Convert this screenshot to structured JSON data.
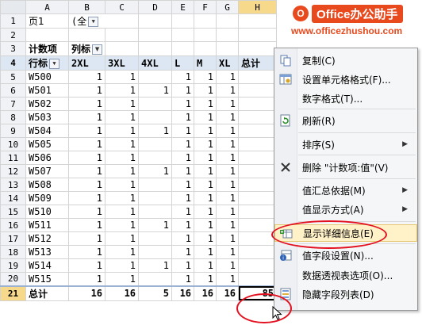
{
  "logo": {
    "badge": "O",
    "brand": "Office办公助手",
    "url": "www.officezhushou.com"
  },
  "sheet": {
    "columns": [
      "A",
      "B",
      "C",
      "D",
      "E",
      "F",
      "G",
      "H"
    ],
    "row_numbers": [
      "1",
      "2",
      "3",
      "4",
      "5",
      "6",
      "7",
      "8",
      "9",
      "10",
      "11",
      "12",
      "13",
      "14",
      "15",
      "16",
      "17",
      "18",
      "19",
      "20",
      "21"
    ],
    "filter": {
      "label": "页1",
      "value": "(全"
    },
    "value_label": "计数项",
    "col_label": "列标",
    "row_label": "行标",
    "headers": [
      "2XL",
      "3XL",
      "4XL",
      "L",
      "M",
      "XL",
      "总计"
    ],
    "rows": [
      {
        "name": "W500",
        "v": [
          "1",
          "1",
          "",
          "1",
          "1",
          "1"
        ]
      },
      {
        "name": "W501",
        "v": [
          "1",
          "1",
          "1",
          "1",
          "1",
          "1"
        ]
      },
      {
        "name": "W502",
        "v": [
          "1",
          "1",
          "",
          "1",
          "1",
          "1"
        ]
      },
      {
        "name": "W503",
        "v": [
          "1",
          "1",
          "",
          "1",
          "1",
          "1"
        ]
      },
      {
        "name": "W504",
        "v": [
          "1",
          "1",
          "1",
          "1",
          "1",
          "1"
        ]
      },
      {
        "name": "W505",
        "v": [
          "1",
          "1",
          "",
          "1",
          "1",
          "1"
        ]
      },
      {
        "name": "W506",
        "v": [
          "1",
          "1",
          "",
          "1",
          "1",
          "1"
        ]
      },
      {
        "name": "W507",
        "v": [
          "1",
          "1",
          "1",
          "1",
          "1",
          "1"
        ]
      },
      {
        "name": "W508",
        "v": [
          "1",
          "1",
          "",
          "1",
          "1",
          "1"
        ]
      },
      {
        "name": "W509",
        "v": [
          "1",
          "1",
          "",
          "1",
          "1",
          "1"
        ]
      },
      {
        "name": "W510",
        "v": [
          "1",
          "1",
          "",
          "1",
          "1",
          "1"
        ]
      },
      {
        "name": "W511",
        "v": [
          "1",
          "1",
          "1",
          "1",
          "1",
          "1"
        ]
      },
      {
        "name": "W512",
        "v": [
          "1",
          "1",
          "",
          "1",
          "1",
          "1"
        ]
      },
      {
        "name": "W513",
        "v": [
          "1",
          "1",
          "",
          "1",
          "1",
          "1"
        ]
      },
      {
        "name": "W514",
        "v": [
          "1",
          "1",
          "1",
          "1",
          "1",
          "1"
        ]
      },
      {
        "name": "W515",
        "v": [
          "1",
          "1",
          "",
          "1",
          "1",
          "1"
        ]
      }
    ],
    "total": {
      "label": "总计",
      "v": [
        "16",
        "16",
        "5",
        "16",
        "16",
        "16"
      ],
      "grand": "85"
    }
  },
  "menu": {
    "items": [
      {
        "label": "复制(C)",
        "icon": "copy-icon",
        "arrow": ""
      },
      {
        "label": "设置单元格格式(F)...",
        "icon": "format-cells-icon",
        "arrow": ""
      },
      {
        "label": "数字格式(T)...",
        "icon": "",
        "arrow": ""
      },
      {
        "label": "刷新(R)",
        "icon": "refresh-icon",
        "arrow": ""
      },
      {
        "label": "排序(S)",
        "icon": "",
        "arrow": "▶"
      },
      {
        "label": "删除 \"计数项:值\"(V)",
        "icon": "delete-x-icon",
        "arrow": ""
      },
      {
        "label": "值汇总依据(M)",
        "icon": "",
        "arrow": "▶"
      },
      {
        "label": "值显示方式(A)",
        "icon": "",
        "arrow": "▶"
      },
      {
        "label": "显示详细信息(E)",
        "icon": "show-detail-icon",
        "arrow": ""
      },
      {
        "label": "值字段设置(N)...",
        "icon": "field-settings-icon",
        "arrow": ""
      },
      {
        "label": "数据透视表选项(O)...",
        "icon": "",
        "arrow": ""
      },
      {
        "label": "隐藏字段列表(D)",
        "icon": "field-list-icon",
        "arrow": ""
      }
    ]
  },
  "colors": {
    "annotation": "#e3101f",
    "brand": "#e8491d",
    "highlight": "#fff1c8"
  }
}
